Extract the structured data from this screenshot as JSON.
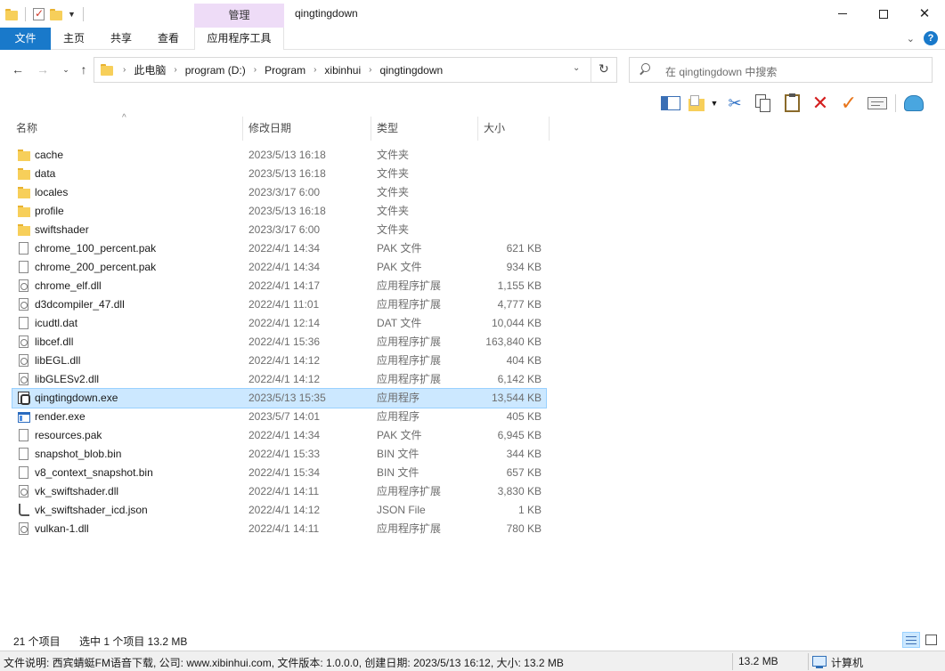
{
  "window": {
    "title": "qingtingdown",
    "context_group": "管理",
    "minimize": "—",
    "close": "✕"
  },
  "ribbon": {
    "tabs": [
      "文件",
      "主页",
      "共享",
      "查看",
      "应用程序工具"
    ],
    "help": "?"
  },
  "address": {
    "crumbs": [
      "此电脑",
      "program (D:)",
      "Program",
      "xibinhui",
      "qingtingdown"
    ],
    "search_placeholder": "在 qingtingdown 中搜索"
  },
  "columns": [
    "名称",
    "修改日期",
    "类型",
    "大小"
  ],
  "files": [
    {
      "icon": "folder",
      "name": "cache",
      "date": "2023/5/13 16:18",
      "type": "文件夹",
      "size": ""
    },
    {
      "icon": "folder",
      "name": "data",
      "date": "2023/5/13 16:18",
      "type": "文件夹",
      "size": ""
    },
    {
      "icon": "folder",
      "name": "locales",
      "date": "2023/3/17 6:00",
      "type": "文件夹",
      "size": ""
    },
    {
      "icon": "folder",
      "name": "profile",
      "date": "2023/5/13 16:18",
      "type": "文件夹",
      "size": ""
    },
    {
      "icon": "folder",
      "name": "swiftshader",
      "date": "2023/3/17 6:00",
      "type": "文件夹",
      "size": ""
    },
    {
      "icon": "doc",
      "name": "chrome_100_percent.pak",
      "date": "2022/4/1 14:34",
      "type": "PAK 文件",
      "size": "621 KB"
    },
    {
      "icon": "doc",
      "name": "chrome_200_percent.pak",
      "date": "2022/4/1 14:34",
      "type": "PAK 文件",
      "size": "934 KB"
    },
    {
      "icon": "dll",
      "name": "chrome_elf.dll",
      "date": "2022/4/1 14:17",
      "type": "应用程序扩展",
      "size": "1,155 KB"
    },
    {
      "icon": "dll",
      "name": "d3dcompiler_47.dll",
      "date": "2022/4/1 11:01",
      "type": "应用程序扩展",
      "size": "4,777 KB"
    },
    {
      "icon": "doc",
      "name": "icudtl.dat",
      "date": "2022/4/1 12:14",
      "type": "DAT 文件",
      "size": "10,044 KB"
    },
    {
      "icon": "dll",
      "name": "libcef.dll",
      "date": "2022/4/1 15:36",
      "type": "应用程序扩展",
      "size": "163,840 KB"
    },
    {
      "icon": "dll",
      "name": "libEGL.dll",
      "date": "2022/4/1 14:12",
      "type": "应用程序扩展",
      "size": "404 KB"
    },
    {
      "icon": "dll",
      "name": "libGLESv2.dll",
      "date": "2022/4/1 14:12",
      "type": "应用程序扩展",
      "size": "6,142 KB"
    },
    {
      "icon": "exe",
      "name": "qingtingdown.exe",
      "date": "2023/5/13 15:35",
      "type": "应用程序",
      "size": "13,544 KB",
      "selected": true
    },
    {
      "icon": "render",
      "name": "render.exe",
      "date": "2023/5/7 14:01",
      "type": "应用程序",
      "size": "405 KB"
    },
    {
      "icon": "doc",
      "name": "resources.pak",
      "date": "2022/4/1 14:34",
      "type": "PAK 文件",
      "size": "6,945 KB"
    },
    {
      "icon": "doc",
      "name": "snapshot_blob.bin",
      "date": "2022/4/1 15:33",
      "type": "BIN 文件",
      "size": "344 KB"
    },
    {
      "icon": "doc",
      "name": "v8_context_snapshot.bin",
      "date": "2022/4/1 15:34",
      "type": "BIN 文件",
      "size": "657 KB"
    },
    {
      "icon": "dll",
      "name": "vk_swiftshader.dll",
      "date": "2022/4/1 14:11",
      "type": "应用程序扩展",
      "size": "3,830 KB"
    },
    {
      "icon": "json",
      "name": "vk_swiftshader_icd.json",
      "date": "2022/4/1 14:12",
      "type": "JSON File",
      "size": "1 KB"
    },
    {
      "icon": "dll",
      "name": "vulkan-1.dll",
      "date": "2022/4/1 14:11",
      "type": "应用程序扩展",
      "size": "780 KB"
    }
  ],
  "status": {
    "count": "21 个项目",
    "selection": "选中 1 个项目  13.2 MB"
  },
  "infobar": {
    "description": "文件说明: 西宾蜻蜓FM语音下载, 公司: www.xibinhui.com, 文件版本: 1.0.0.0, 创建日期: 2023/5/13 16:12, 大小: 13.2 MB",
    "size": "13.2 MB",
    "computer": "计算机"
  }
}
